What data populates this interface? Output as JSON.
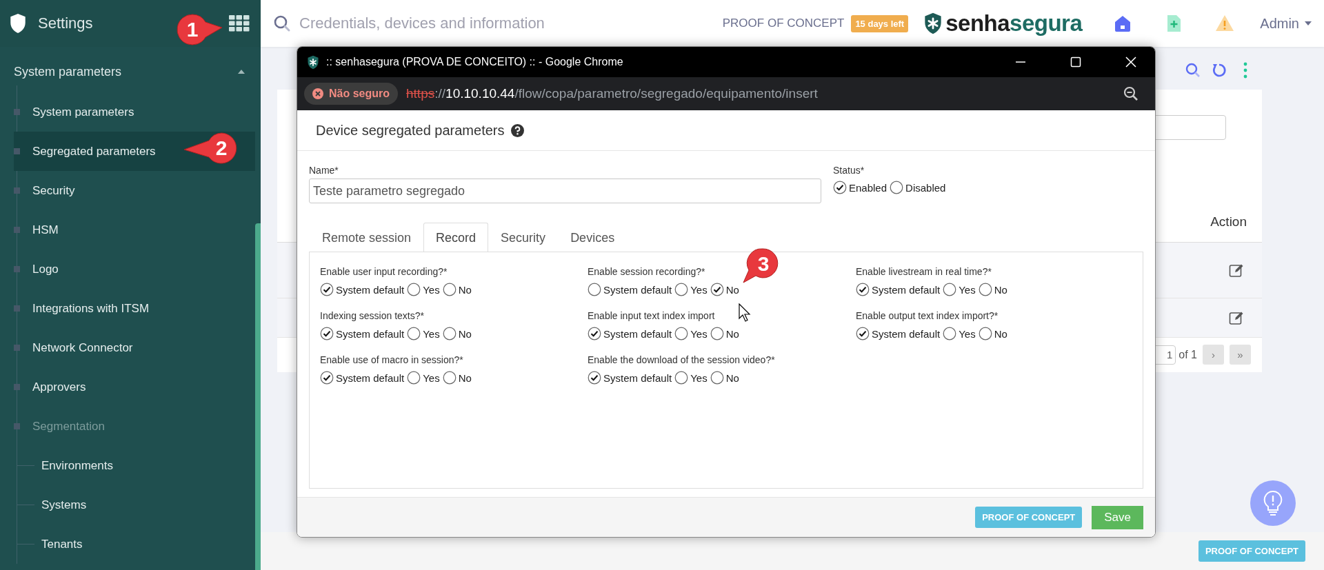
{
  "sidebar": {
    "title": "Settings",
    "section": {
      "label": "System parameters",
      "expanded": true
    },
    "items": [
      {
        "label": "System parameters",
        "selected": false,
        "disabled": false
      },
      {
        "label": "Segregated parameters",
        "selected": true,
        "disabled": false
      },
      {
        "label": "Security",
        "selected": false,
        "disabled": false
      },
      {
        "label": "HSM",
        "selected": false,
        "disabled": false
      },
      {
        "label": "Logo",
        "selected": false,
        "disabled": false
      },
      {
        "label": "Integrations with ITSM",
        "selected": false,
        "disabled": false
      },
      {
        "label": "Network Connector",
        "selected": false,
        "disabled": false
      },
      {
        "label": "Approvers",
        "selected": false,
        "disabled": false
      },
      {
        "label": "Segmentation",
        "selected": false,
        "disabled": true,
        "children": [
          {
            "label": "Environments"
          },
          {
            "label": "Systems"
          },
          {
            "label": "Tenants"
          }
        ]
      }
    ]
  },
  "topbar": {
    "search": {
      "placeholder": "Credentials, devices and information"
    },
    "plan": "PROOF OF CONCEPT",
    "trial_badge": "15 days left",
    "logo": {
      "first": "senha",
      "second": "segura"
    },
    "user": "Admin"
  },
  "background": {
    "column": "Action",
    "rows": [
      {
        "kind": "edit"
      },
      {
        "kind": "edit"
      }
    ],
    "pagination": {
      "page": "1",
      "of": "of 1",
      "next": "›",
      "last": "»"
    }
  },
  "footer": {
    "button": "PROOF OF CONCEPT"
  },
  "popup": {
    "window_title": ":: senhasegura (PROVA DE CONCEITO) :: - Google Chrome",
    "security_chip": "Não seguro",
    "url": {
      "scheme": "https",
      "separator": "://",
      "host": "10.10.10.44",
      "path": "/flow/copa/parametro/segregado/equipamento/insert"
    },
    "heading": "Device segregated parameters",
    "name": {
      "label": "Name*",
      "value": "Teste parametro segregado"
    },
    "status": {
      "label": "Status*",
      "options": [
        {
          "label": "Enabled",
          "selected": true
        },
        {
          "label": "Disabled",
          "selected": false
        }
      ]
    },
    "tabs": [
      {
        "label": "Remote session",
        "selected": false
      },
      {
        "label": "Record",
        "selected": true
      },
      {
        "label": "Security",
        "selected": false
      },
      {
        "label": "Devices",
        "selected": false
      }
    ],
    "fields": [
      {
        "label": "Enable user input recording?*",
        "options": [
          {
            "label": "System default",
            "selected": true
          },
          {
            "label": "Yes",
            "selected": false
          },
          {
            "label": "No",
            "selected": false
          }
        ]
      },
      {
        "label": "Enable session recording?*",
        "options": [
          {
            "label": "System default",
            "selected": false
          },
          {
            "label": "Yes",
            "selected": false
          },
          {
            "label": "No",
            "selected": true
          }
        ]
      },
      {
        "label": "Enable livestream in real time?*",
        "options": [
          {
            "label": "System default",
            "selected": true
          },
          {
            "label": "Yes",
            "selected": false
          },
          {
            "label": "No",
            "selected": false
          }
        ]
      },
      {
        "label": "Indexing session texts?*",
        "options": [
          {
            "label": "System default",
            "selected": true
          },
          {
            "label": "Yes",
            "selected": false
          },
          {
            "label": "No",
            "selected": false
          }
        ]
      },
      {
        "label": "Enable input text index import",
        "options": [
          {
            "label": "System default",
            "selected": true
          },
          {
            "label": "Yes",
            "selected": false
          },
          {
            "label": "No",
            "selected": false
          }
        ]
      },
      {
        "label": "Enable output text index import?*",
        "options": [
          {
            "label": "System default",
            "selected": true
          },
          {
            "label": "Yes",
            "selected": false
          },
          {
            "label": "No",
            "selected": false
          }
        ]
      },
      {
        "label": "Enable use of macro in session?*",
        "options": [
          {
            "label": "System default",
            "selected": true
          },
          {
            "label": "Yes",
            "selected": false
          },
          {
            "label": "No",
            "selected": false
          }
        ]
      },
      {
        "label": "Enable the download of the session video?*",
        "options": [
          {
            "label": "System default",
            "selected": true
          },
          {
            "label": "Yes",
            "selected": false
          },
          {
            "label": "No",
            "selected": false
          }
        ]
      }
    ],
    "buttons": [
      {
        "label": "PROOF OF CONCEPT",
        "kind": "badge"
      },
      {
        "label": "Save",
        "kind": "primary"
      }
    ]
  },
  "annotations": [
    {
      "number": "1",
      "kind": "right"
    },
    {
      "number": "2",
      "kind": "left"
    },
    {
      "number": "3",
      "kind": "down"
    }
  ]
}
